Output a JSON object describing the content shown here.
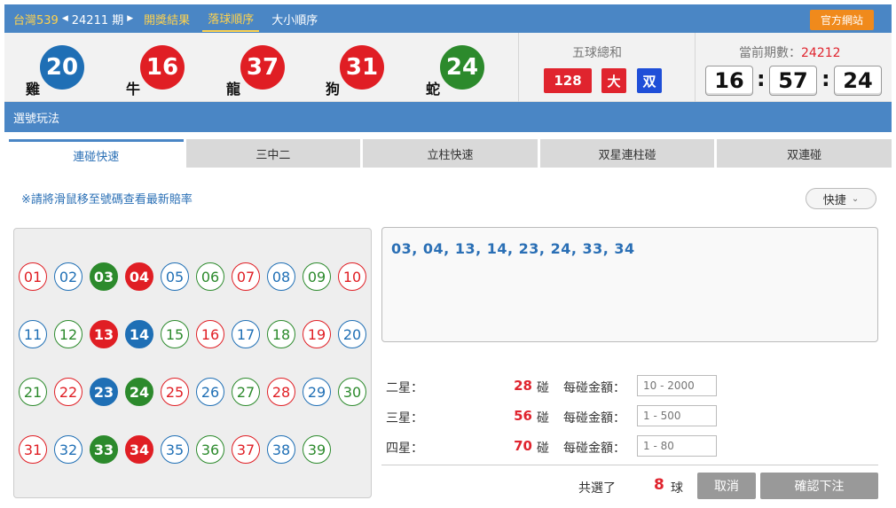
{
  "header": {
    "lottery": "台灣539",
    "period": "24211 期",
    "nav": [
      "開獎結果",
      "落球順序",
      "大小順序"
    ],
    "official_button": "官方網站"
  },
  "result": {
    "balls": [
      {
        "number": "20",
        "zodiac": "雞",
        "color": "#1f6fb5"
      },
      {
        "number": "16",
        "zodiac": "牛",
        "color": "#e01e24"
      },
      {
        "number": "37",
        "zodiac": "龍",
        "color": "#e01e24"
      },
      {
        "number": "31",
        "zodiac": "狗",
        "color": "#e01e24"
      },
      {
        "number": "24",
        "zodiac": "蛇",
        "color": "#2c8a2c"
      }
    ],
    "sum_title": "五球總和",
    "sum_value": "128",
    "size": "大",
    "parity": "双",
    "current_period_label": "當前期數：",
    "current_period": "24212",
    "clock": {
      "h": "16",
      "m": "57",
      "s": "24"
    }
  },
  "section_title": "選號玩法",
  "tabs": [
    "連碰快速",
    "三中二",
    "立柱快速",
    "双星連柱碰",
    "双連碰"
  ],
  "notice": "※請將滑鼠移至號碼查看最新賠率",
  "quick_button": "快捷",
  "numbers": [
    {
      "n": "01",
      "c": "#e01e24",
      "sel": false
    },
    {
      "n": "02",
      "c": "#1f6fb5",
      "sel": false
    },
    {
      "n": "03",
      "c": "#2c8a2c",
      "sel": true
    },
    {
      "n": "04",
      "c": "#e01e24",
      "sel": true
    },
    {
      "n": "05",
      "c": "#1f6fb5",
      "sel": false
    },
    {
      "n": "06",
      "c": "#2c8a2c",
      "sel": false
    },
    {
      "n": "07",
      "c": "#e01e24",
      "sel": false
    },
    {
      "n": "08",
      "c": "#1f6fb5",
      "sel": false
    },
    {
      "n": "09",
      "c": "#2c8a2c",
      "sel": false
    },
    {
      "n": "10",
      "c": "#e01e24",
      "sel": false
    },
    {
      "n": "11",
      "c": "#1f6fb5",
      "sel": false
    },
    {
      "n": "12",
      "c": "#2c8a2c",
      "sel": false
    },
    {
      "n": "13",
      "c": "#e01e24",
      "sel": true
    },
    {
      "n": "14",
      "c": "#1f6fb5",
      "sel": true
    },
    {
      "n": "15",
      "c": "#2c8a2c",
      "sel": false
    },
    {
      "n": "16",
      "c": "#e01e24",
      "sel": false
    },
    {
      "n": "17",
      "c": "#1f6fb5",
      "sel": false
    },
    {
      "n": "18",
      "c": "#2c8a2c",
      "sel": false
    },
    {
      "n": "19",
      "c": "#e01e24",
      "sel": false
    },
    {
      "n": "20",
      "c": "#1f6fb5",
      "sel": false
    },
    {
      "n": "21",
      "c": "#2c8a2c",
      "sel": false
    },
    {
      "n": "22",
      "c": "#e01e24",
      "sel": false
    },
    {
      "n": "23",
      "c": "#1f6fb5",
      "sel": true
    },
    {
      "n": "24",
      "c": "#2c8a2c",
      "sel": true
    },
    {
      "n": "25",
      "c": "#e01e24",
      "sel": false
    },
    {
      "n": "26",
      "c": "#1f6fb5",
      "sel": false
    },
    {
      "n": "27",
      "c": "#2c8a2c",
      "sel": false
    },
    {
      "n": "28",
      "c": "#e01e24",
      "sel": false
    },
    {
      "n": "29",
      "c": "#1f6fb5",
      "sel": false
    },
    {
      "n": "30",
      "c": "#2c8a2c",
      "sel": false
    },
    {
      "n": "31",
      "c": "#e01e24",
      "sel": false
    },
    {
      "n": "32",
      "c": "#1f6fb5",
      "sel": false
    },
    {
      "n": "33",
      "c": "#2c8a2c",
      "sel": true
    },
    {
      "n": "34",
      "c": "#e01e24",
      "sel": true
    },
    {
      "n": "35",
      "c": "#1f6fb5",
      "sel": false
    },
    {
      "n": "36",
      "c": "#2c8a2c",
      "sel": false
    },
    {
      "n": "37",
      "c": "#e01e24",
      "sel": false
    },
    {
      "n": "38",
      "c": "#1f6fb5",
      "sel": false
    },
    {
      "n": "39",
      "c": "#2c8a2c",
      "sel": false
    }
  ],
  "selected_text": "03, 04, 13, 14, 23, 24, 33, 34",
  "bet_rows": [
    {
      "label": "二星：",
      "count": "28",
      "unit": "碰",
      "amount_label": "每碰金額：",
      "placeholder": "10 - 2000"
    },
    {
      "label": "三星：",
      "count": "56",
      "unit": "碰",
      "amount_label": "每碰金額：",
      "placeholder": "1 - 500"
    },
    {
      "label": "四星：",
      "count": "70",
      "unit": "碰",
      "amount_label": "每碰金額：",
      "placeholder": "1 - 80"
    }
  ],
  "footer": {
    "total_label": "共選了",
    "total_count": "8",
    "total_unit": "球",
    "cancel": "取消",
    "confirm": "確認下注"
  }
}
